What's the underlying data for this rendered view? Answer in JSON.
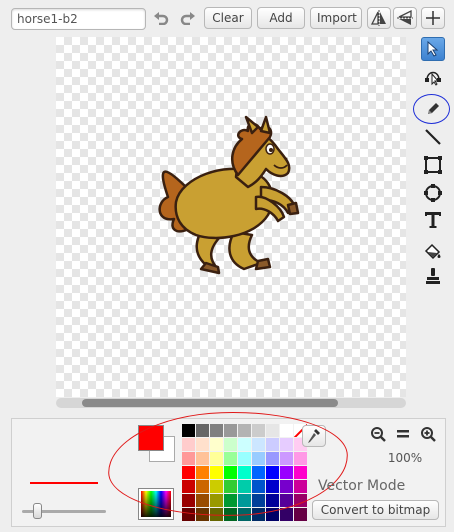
{
  "costume": {
    "name": "horse1-b2"
  },
  "toolbar": {
    "undo_icon": "undo-icon",
    "redo_icon": "redo-icon",
    "clear_label": "Clear",
    "add_label": "Add",
    "import_label": "Import",
    "flip_horizontal_icon": "flip-horizontal-icon",
    "flip_vertical_icon": "flip-vertical-icon",
    "set_center_icon": "crosshair-icon"
  },
  "tools": [
    {
      "name": "select",
      "icon": "arrow-pointer-icon",
      "selected": true
    },
    {
      "name": "reshape",
      "icon": "reshape-icon",
      "selected": false
    },
    {
      "name": "pencil",
      "icon": "pencil-icon",
      "selected": false
    },
    {
      "name": "line",
      "icon": "line-icon",
      "selected": false
    },
    {
      "name": "rectangle",
      "icon": "rectangle-icon",
      "selected": false
    },
    {
      "name": "ellipse",
      "icon": "ellipse-icon",
      "selected": false
    },
    {
      "name": "text",
      "icon": "text-icon",
      "selected": false
    },
    {
      "name": "fill",
      "icon": "paint-bucket-icon",
      "selected": false
    },
    {
      "name": "stamp",
      "icon": "stamp-icon",
      "selected": false
    }
  ],
  "colors": {
    "foreground": "#ff0000",
    "background": "#ffffff",
    "stroke_preview": "#ff0000",
    "accent": "#3d82d0",
    "palette": [
      [
        "#000000",
        "#666666",
        "#808080",
        "#999999",
        "#b3b3b3",
        "#cccccc",
        "#e6e6e6",
        "#ffffff",
        "none"
      ],
      [
        "#ffcccc",
        "#ffe0cc",
        "#ffffcc",
        "#ccffcc",
        "#ccffff",
        "#cce6ff",
        "#ccccff",
        "#e6ccff",
        "#ffccf2"
      ],
      [
        "#ff9999",
        "#ffc299",
        "#ffff99",
        "#99ff99",
        "#99ffff",
        "#99ccff",
        "#9999ff",
        "#cc99ff",
        "#ff99e6"
      ],
      [
        "#ff0000",
        "#ff8000",
        "#ffff00",
        "#00ff00",
        "#00ffcc",
        "#0066ff",
        "#0000ff",
        "#9900ff",
        "#ff00cc"
      ],
      [
        "#cc0000",
        "#cc6600",
        "#cccc00",
        "#33cc33",
        "#00ccaa",
        "#0055cc",
        "#0000cc",
        "#7700cc",
        "#cc0099"
      ],
      [
        "#990000",
        "#994c00",
        "#999900",
        "#009933",
        "#009999",
        "#004099",
        "#000099",
        "#550099",
        "#990066"
      ],
      [
        "#660000",
        "#663300",
        "#666600",
        "#006622",
        "#006666",
        "#002b66",
        "#000066",
        "#330066",
        "#660044"
      ]
    ]
  },
  "zoom": {
    "out_icon": "zoom-out-icon",
    "reset_icon": "zoom-reset-icon",
    "in_icon": "zoom-in-icon",
    "level": "100%"
  },
  "mode": {
    "label": "Vector Mode",
    "convert_label": "Convert to bitmap"
  },
  "brush_size": 0.15
}
